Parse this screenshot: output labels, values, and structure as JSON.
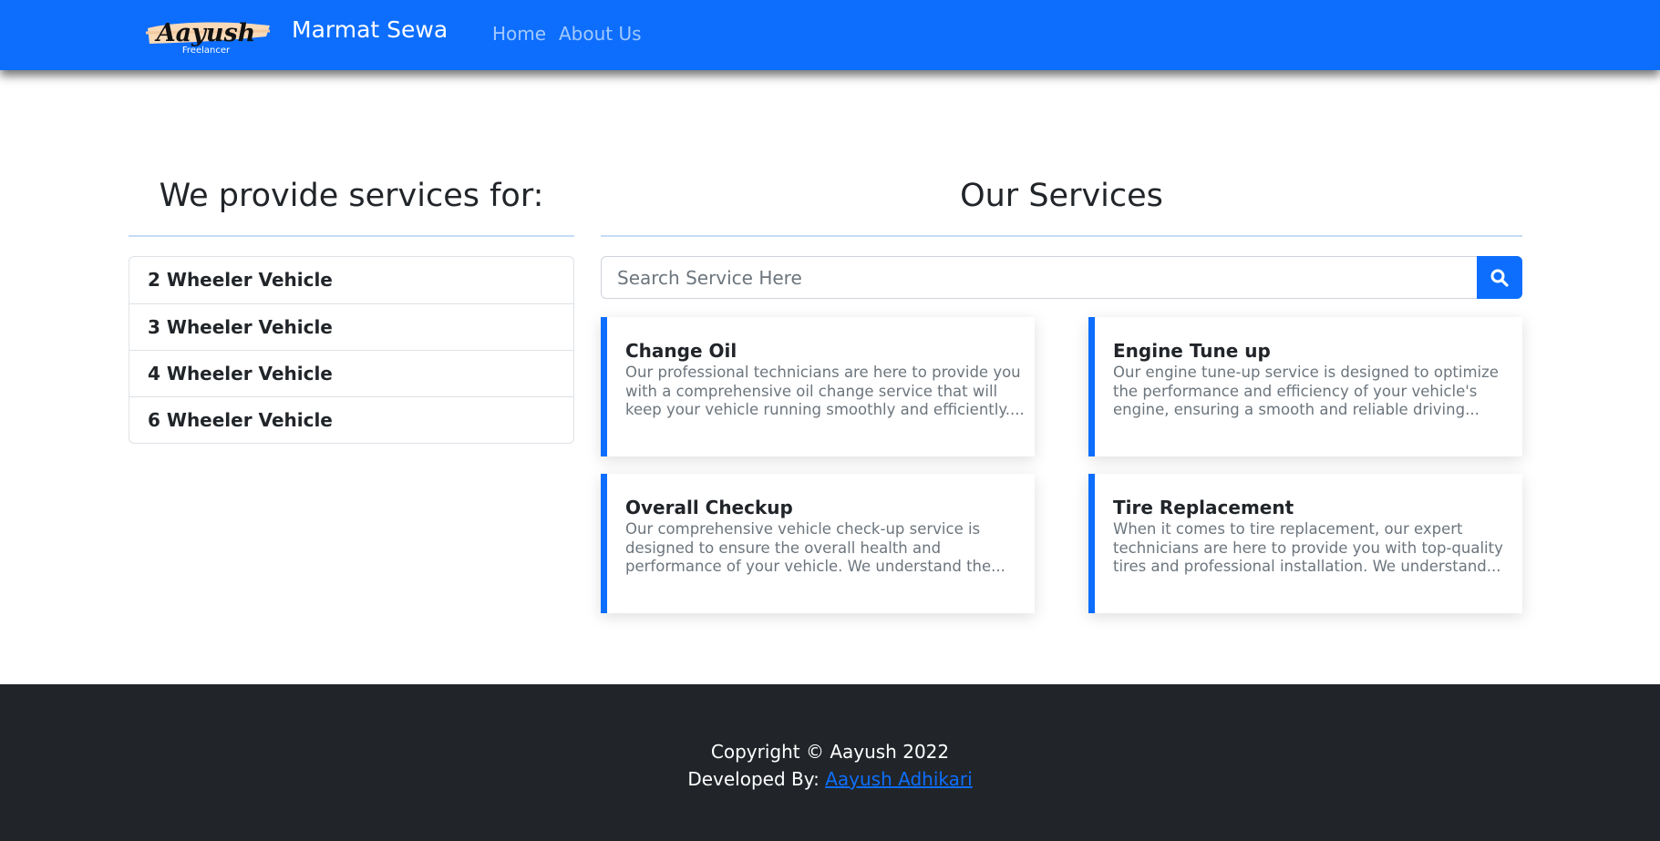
{
  "navbar": {
    "logo_text": "Aayush",
    "logo_subtext": "Freelancer",
    "brand": "Marmat Sewa",
    "links": [
      "Home",
      "About Us"
    ]
  },
  "vehicles": {
    "heading": "We provide services for:",
    "items": [
      "2 Wheeler Vehicle",
      "3 Wheeler Vehicle",
      "4 Wheeler Vehicle",
      "6 Wheeler Vehicle"
    ]
  },
  "services": {
    "heading": "Our Services",
    "search": {
      "placeholder": "Search Service Here",
      "icon": "search-icon"
    },
    "cards": [
      {
        "title": "Change Oil",
        "lines": [
          "Our professional technicians are here to provide you",
          "with a comprehensive oil change service that will",
          "keep your vehicle running smoothly and efficiently...."
        ]
      },
      {
        "title": "Engine Tune up",
        "lines": [
          "Our engine tune-up service is designed to optimize",
          "the performance and efficiency of your vehicle's",
          "engine, ensuring a smooth and reliable driving..."
        ]
      },
      {
        "title": "Overall Checkup",
        "lines": [
          "Our comprehensive vehicle check-up service is",
          "designed to ensure the overall health and",
          "performance of your vehicle. We understand the..."
        ]
      },
      {
        "title": "Tire Replacement",
        "lines": [
          "When it comes to tire replacement, our expert",
          "technicians are here to provide you with top-quality",
          "tires and professional installation. We understand..."
        ]
      }
    ]
  },
  "footer": {
    "copyright": "Copyright © Aayush 2022",
    "developed_prefix": "Developed By:",
    "developer_name": "Aayush Adhikari"
  },
  "colors": {
    "primary": "#0d6efd",
    "footer_bg": "#212529",
    "muted_text": "#6c757d"
  }
}
